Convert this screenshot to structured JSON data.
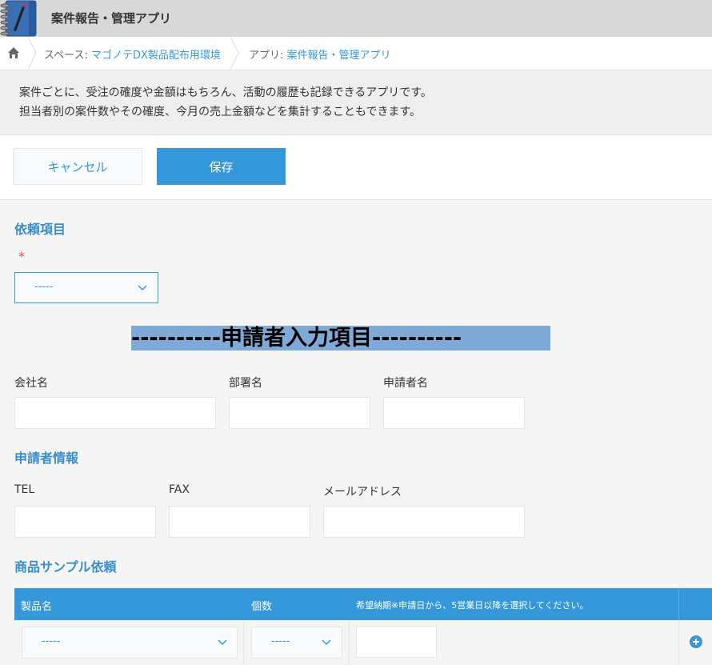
{
  "app": {
    "title": "案件報告・管理アプリ"
  },
  "breadcrumb": {
    "space_prefix": "スペース: ",
    "space_name": "マゴノテDX製品配布用環境",
    "app_prefix": "アプリ: ",
    "app_name": "案件報告・管理アプリ"
  },
  "description": {
    "line1": "案件ごとに、受注の確度や金額はもちろん、活動の履歴も記録できるアプリです。",
    "line2": "担当者別の案件数やその確度、今月の売上金額などを集計することもできます。"
  },
  "toolbar": {
    "cancel_label": "キャンセル",
    "save_label": "保存"
  },
  "form": {
    "request_item": {
      "title": "依頼項目",
      "required_mark": "*",
      "selected": "-----"
    },
    "applicant_header": "----------申請者入力項目----------",
    "company_label": "会社名",
    "department_label": "部署名",
    "applicant_name_label": "申請者名",
    "applicant_info_title": "申請者情報",
    "tel_label": "TEL",
    "fax_label": "FAX",
    "email_label": "メールアドレス",
    "sample_request_title": "商品サンプル依頼"
  },
  "table": {
    "columns": [
      "製品名",
      "個数",
      "希望納期※申請日から、5営業日以降を選択してください。"
    ],
    "row": {
      "product_selected": "-----",
      "quantity_selected": "-----"
    }
  },
  "colors": {
    "accent": "#3498db",
    "section_title": "#3a8dcb",
    "header_bg": "#d8d8d8"
  }
}
